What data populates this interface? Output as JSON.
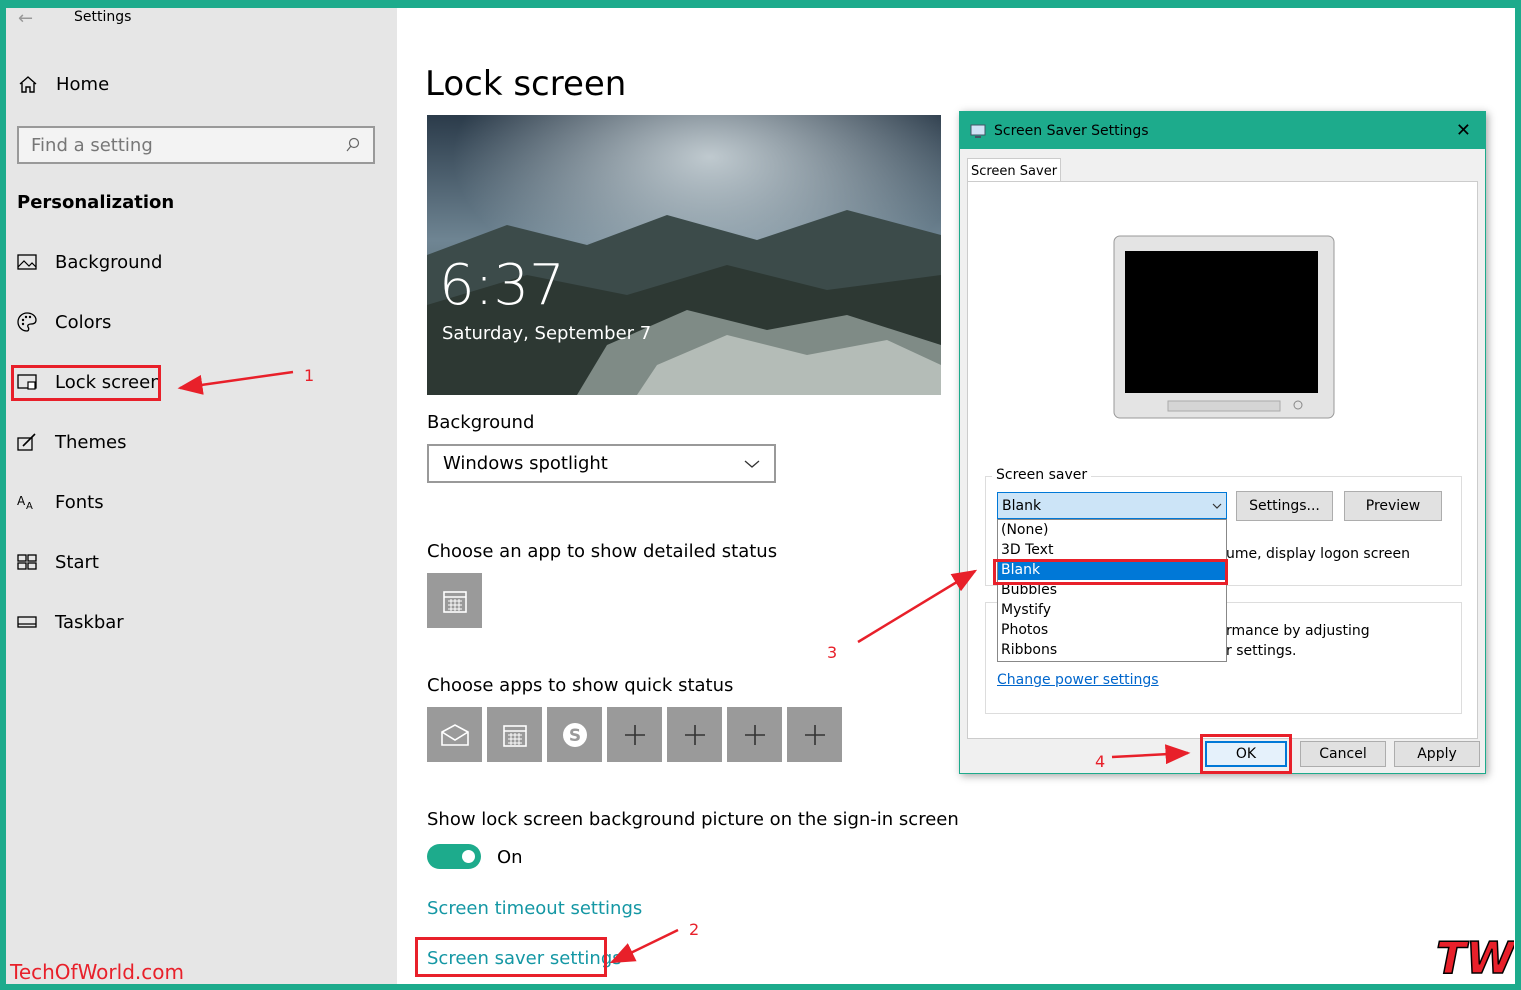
{
  "sidebar": {
    "app_title": "Settings",
    "home_label": "Home",
    "search_placeholder": "Find a setting",
    "section_title": "Personalization",
    "items": [
      {
        "label": "Background",
        "icon": "image-icon"
      },
      {
        "label": "Colors",
        "icon": "palette-icon"
      },
      {
        "label": "Lock screen",
        "icon": "lock-screen-icon"
      },
      {
        "label": "Themes",
        "icon": "brush-icon"
      },
      {
        "label": "Fonts",
        "icon": "font-icon"
      },
      {
        "label": "Start",
        "icon": "start-icon"
      },
      {
        "label": "Taskbar",
        "icon": "taskbar-icon"
      }
    ]
  },
  "main": {
    "title": "Lock screen",
    "preview_time": "6:37",
    "preview_date": "Saturday, September 7",
    "background_label": "Background",
    "background_value": "Windows spotlight",
    "detailed_status_label": "Choose an app to show detailed status",
    "quick_status_label": "Choose apps to show quick status",
    "signin_label": "Show lock screen background picture on the sign-in screen",
    "toggle_state": "On",
    "timeout_link": "Screen timeout settings",
    "screensaver_link": "Screen saver settings"
  },
  "dialog": {
    "title": "Screen Saver Settings",
    "tab": "Screen Saver",
    "group_label": "Screen saver",
    "selected": "Blank",
    "options": [
      "(None)",
      "3D Text",
      "Blank",
      "Bubbles",
      "Mystify",
      "Photos",
      "Ribbons"
    ],
    "settings_button": "Settings...",
    "preview_button": "Preview",
    "resume_text": "ume, display logon screen",
    "power_text_1": "rmance by adjusting",
    "power_text_2": "r settings.",
    "power_link": "Change power settings",
    "ok": "OK",
    "cancel": "Cancel",
    "apply": "Apply"
  },
  "annotations": {
    "n1": "1",
    "n2": "2",
    "n3": "3",
    "n4": "4"
  },
  "watermark": "TechOfWorld.com",
  "logo": "TW",
  "colors": {
    "accent": "#1dab8c",
    "highlight": "#e8202a",
    "link": "#1497a4",
    "selection": "#0078d7"
  }
}
